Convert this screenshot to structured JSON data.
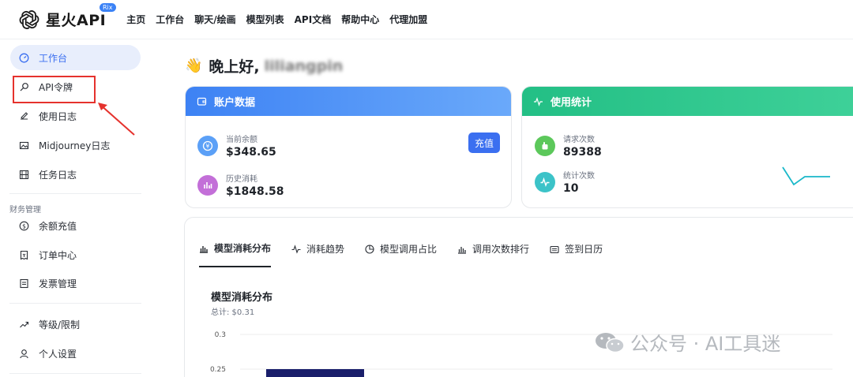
{
  "header": {
    "brand": "星火API",
    "badge": "Rix",
    "nav": [
      "主页",
      "工作台",
      "聊天/绘画",
      "模型列表",
      "API文档",
      "帮助中心",
      "代理加盟"
    ]
  },
  "sidebar": {
    "items": [
      {
        "label": "工作台",
        "icon": "dashboard-icon",
        "active": true
      },
      {
        "label": "API令牌",
        "icon": "key-icon"
      },
      {
        "label": "使用日志",
        "icon": "log-icon"
      },
      {
        "label": "Midjourney日志",
        "icon": "image-icon"
      },
      {
        "label": "任务日志",
        "icon": "film-icon"
      }
    ],
    "finance_group": "财务管理",
    "finance_items": [
      {
        "label": "余额充值",
        "icon": "coin-icon"
      },
      {
        "label": "订单中心",
        "icon": "receipt-icon"
      },
      {
        "label": "发票管理",
        "icon": "invoice-icon"
      }
    ],
    "other_items": [
      {
        "label": "等级/限制",
        "icon": "trend-icon"
      },
      {
        "label": "个人设置",
        "icon": "user-icon"
      }
    ]
  },
  "greeting": {
    "emoji": "👋",
    "text": "晚上好, ",
    "name": "liliangpin"
  },
  "account_card": {
    "title": "账户数据",
    "balance_label": "当前余额",
    "balance_value": "$348.65",
    "recharge_label": "充值",
    "spent_label": "历史消耗",
    "spent_value": "$1848.58",
    "color": "#4f8ff7"
  },
  "usage_card": {
    "title": "使用统计",
    "requests_label": "请求次数",
    "requests_value": "89388",
    "count_label": "统计次数",
    "count_value": "10",
    "color": "#2ec48c"
  },
  "tabs": [
    "模型消耗分布",
    "消耗趋势",
    "模型调用占比",
    "调用次数排行",
    "签到日历"
  ],
  "chart_data": {
    "type": "bar",
    "title": "模型消耗分布",
    "subtitle": "总计: $0.31",
    "y_ticks": [
      "0.3",
      "0.25"
    ],
    "ylim": [
      0,
      0.3
    ],
    "series": [
      {
        "values": [
          0.25
        ]
      }
    ],
    "color": "#1a1f6b"
  },
  "watermark": "公众号 · AI工具迷"
}
